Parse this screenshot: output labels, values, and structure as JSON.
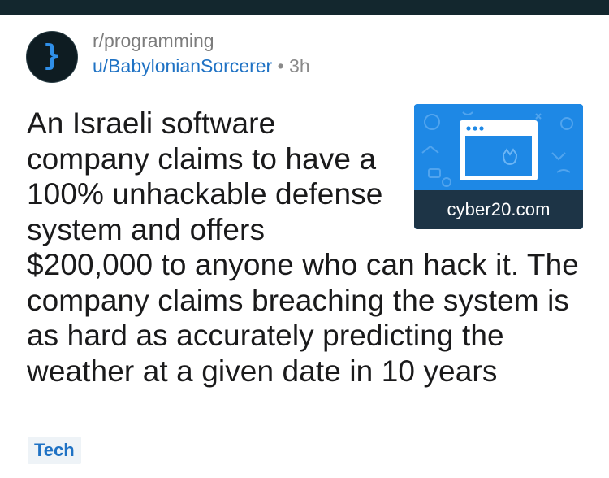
{
  "post": {
    "subreddit": "r/programming",
    "author": "u/BabylonianSorcerer",
    "separator": "•",
    "time": "3h",
    "avatar_glyph": "}",
    "title": "An Israeli software company claims to have a 100% unhackable defense system and offers $200,000 to anyone who can hack it. The company claims breaching the system is as hard as accurately predicting the weather at a given date in 10 years",
    "thumbnail": {
      "domain": "cyber20.com",
      "icon": "browser-window-icon"
    },
    "flair": "Tech"
  },
  "colors": {
    "topbar": "#13272e",
    "link_blue": "#1f72c4",
    "thumbnail_blue": "#1e88e5",
    "flair_bg": "#eef3f7"
  }
}
